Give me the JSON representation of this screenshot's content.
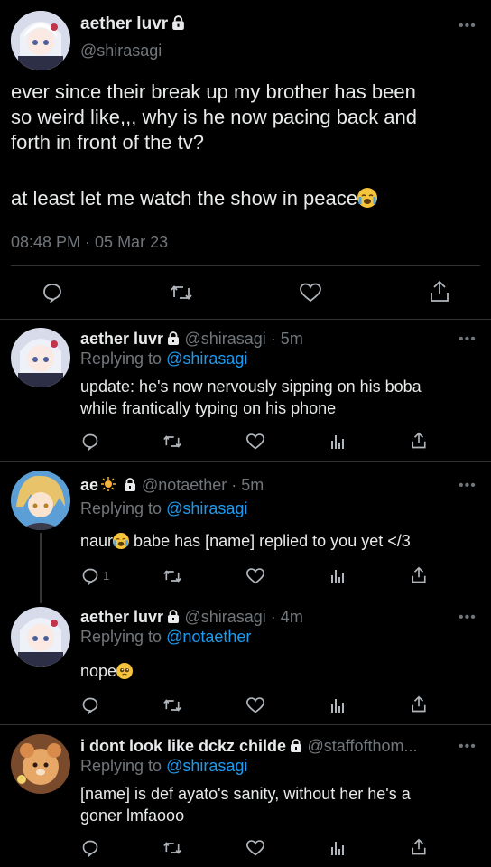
{
  "colors": {
    "background": "#000000",
    "text": "#e7e9ea",
    "muted": "#71767b",
    "link": "#1d9bf0",
    "divider": "#2f3336"
  },
  "main_tweet": {
    "display_name": "aether luvr",
    "handle": "@shirasagi",
    "text_lines": [
      "ever since their break up my brother has been",
      "so weird like,,, why is he now pacing back and",
      "forth in front of the tv?",
      "at least let me watch the show in peace"
    ],
    "timestamp": "08:48 PM · 05 Mar 23",
    "icons": [
      "reply-icon",
      "retweet-icon",
      "like-icon",
      "share-icon"
    ]
  },
  "replies": [
    {
      "display_name": "aether luvr",
      "handle": "@shirasagi · 5m",
      "replying_label": "Replying to",
      "replying_to": "@shirasagi",
      "text_lines": [
        "update: he's now nervously sipping on his boba",
        "while frantically typing on his phone"
      ],
      "reply_count": ""
    },
    {
      "display_name": "ae",
      "handle": "@notaether · 5m",
      "replying_label": "Replying to",
      "replying_to": "@shirasagi",
      "text_lines": [
        "naur",
        " babe has [name] replied to you yet </3"
      ],
      "reply_count": "1"
    },
    {
      "display_name": "aether luvr",
      "handle": "@shirasagi · 4m",
      "replying_label": "Replying to",
      "replying_to": "@notaether",
      "text_lines": [
        "nope"
      ],
      "reply_count": ""
    },
    {
      "display_name": "i dont look like dckz childe",
      "handle": "@staffofthom...",
      "replying_label": "Replying to",
      "replying_to": "@shirasagi",
      "text_lines": [
        "[name] is def ayato's sanity, without her he's a",
        "goner lmfaooo"
      ],
      "reply_count": ""
    }
  ]
}
